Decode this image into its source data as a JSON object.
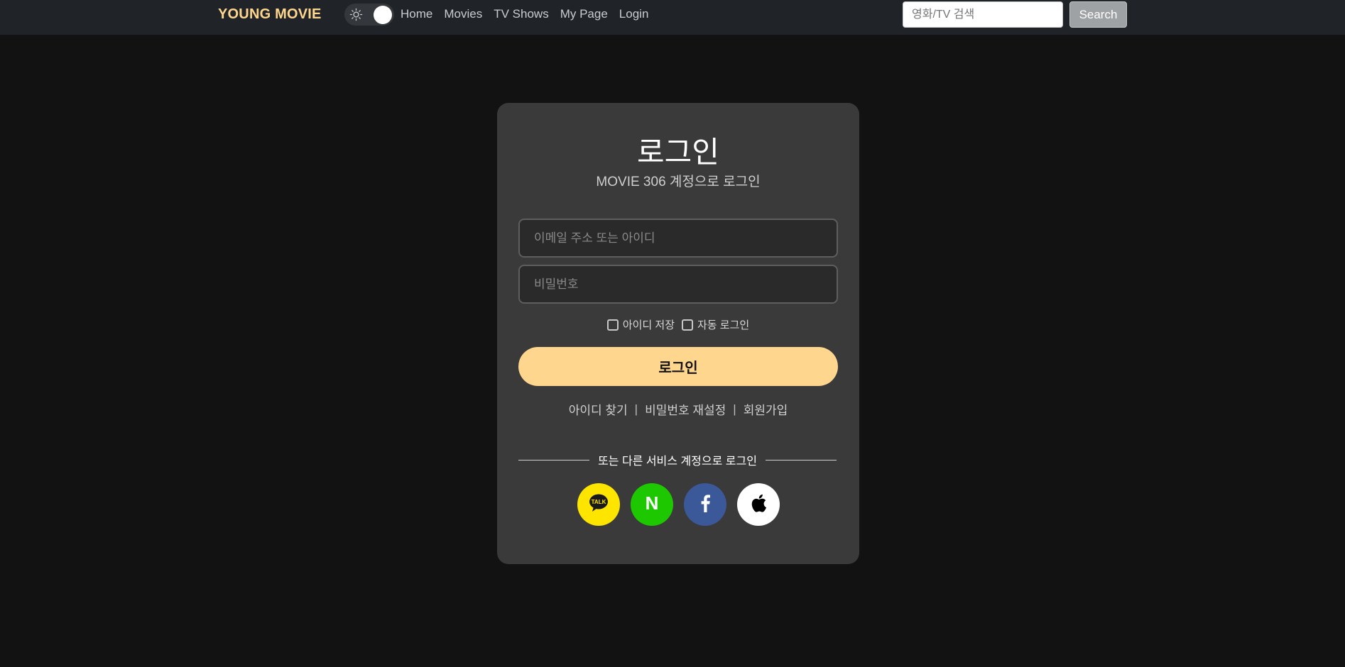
{
  "navbar": {
    "brand": "YOUNG MOVIE",
    "theme_toggle_icon": "sun-icon",
    "links": [
      "Home",
      "Movies",
      "TV Shows",
      "My Page",
      "Login"
    ],
    "search_placeholder": "영화/TV 검색",
    "search_button": "Search"
  },
  "login": {
    "title": "로그인",
    "subtitle": "MOVIE 306 계정으로 로그인",
    "email_placeholder": "이메일 주소 또는 아이디",
    "password_placeholder": "비밀번호",
    "save_id_label": "아이디 저장",
    "auto_login_label": "자동 로그인",
    "login_button": "로그인",
    "find_id_link": "아이디 찾기",
    "reset_password_link": "비밀번호 재설정",
    "signup_link": "회원가입",
    "separator": "|",
    "divider_text": "또는 다른 서비스 계정으로 로그인",
    "social": [
      {
        "name": "kakao",
        "icon": "kakao-talk-icon",
        "text": "TALK"
      },
      {
        "name": "naver",
        "icon": "naver-icon",
        "text": "N"
      },
      {
        "name": "facebook",
        "icon": "facebook-icon"
      },
      {
        "name": "apple",
        "icon": "apple-icon"
      }
    ]
  },
  "colors": {
    "accent": "#ffd68e",
    "background": "#121212",
    "card": "#3a3a3a",
    "navbar": "#202328",
    "kakao": "#fee500",
    "naver": "#1ec800",
    "facebook": "#3b5998",
    "apple": "#ffffff"
  }
}
